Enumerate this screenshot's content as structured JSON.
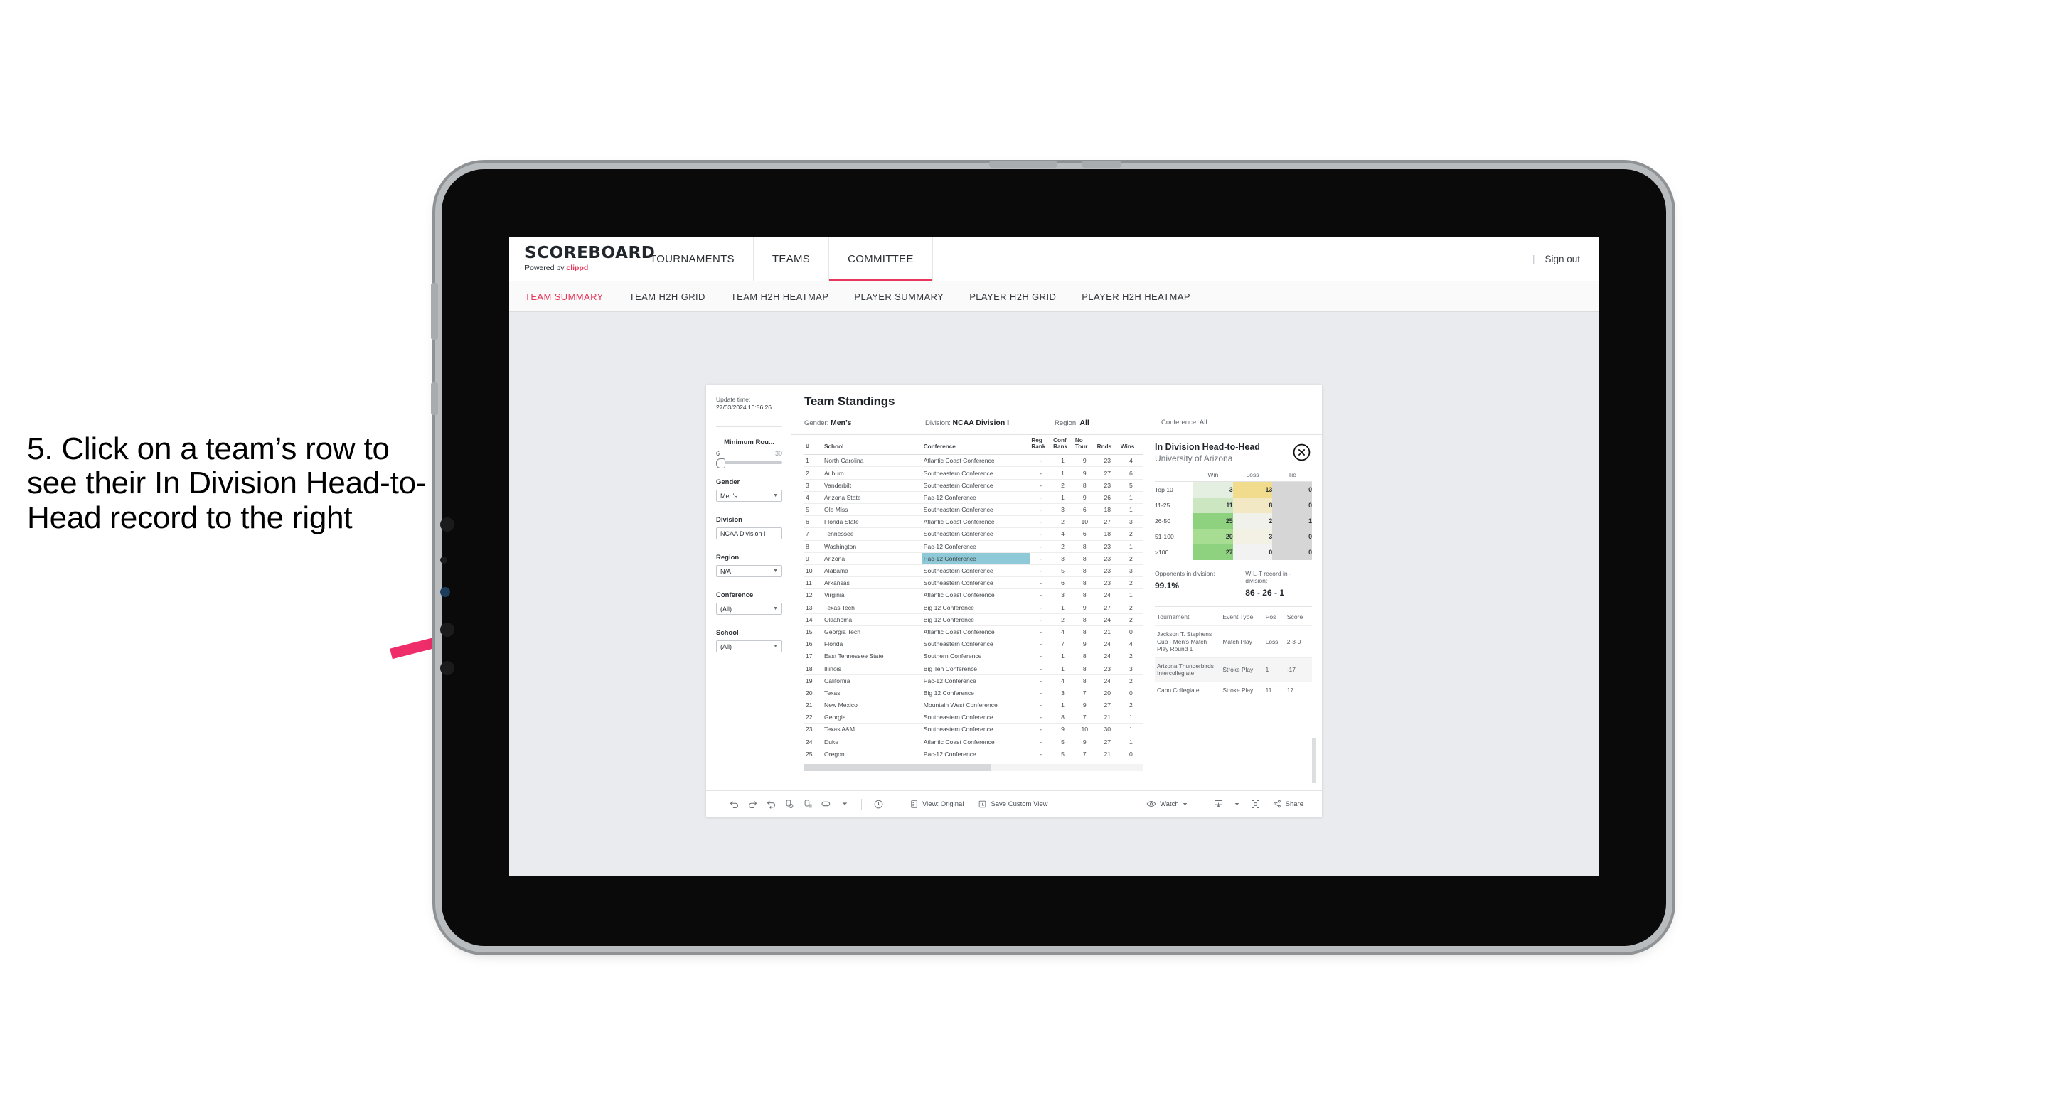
{
  "annotation": {
    "text": "5. Click on a team’s row to see their In Division Head-to-Head record to the right"
  },
  "app": {
    "logo_word": "SCOREBOARD",
    "logo_sub_prefix": "Powered by ",
    "logo_sub_brand": "clippd",
    "nav": [
      {
        "label": "TOURNAMENTS",
        "active": false
      },
      {
        "label": "TEAMS",
        "active": false
      },
      {
        "label": "COMMITTEE",
        "active": true
      }
    ],
    "sign_out": "Sign out",
    "subtabs": [
      {
        "label": "TEAM SUMMARY",
        "active": true
      },
      {
        "label": "TEAM H2H GRID",
        "active": false
      },
      {
        "label": "TEAM H2H HEATMAP",
        "active": false
      },
      {
        "label": "PLAYER SUMMARY",
        "active": false
      },
      {
        "label": "PLAYER H2H GRID",
        "active": false
      },
      {
        "label": "PLAYER H2H HEATMAP",
        "active": false
      }
    ]
  },
  "filters": {
    "update_time_label": "Update time:",
    "update_time_value": "27/03/2024 16:56:26",
    "min_rounds": {
      "label": "Minimum Rou...",
      "low": "6",
      "high": "30"
    },
    "groups": [
      {
        "label": "Gender",
        "value": "Men’s"
      },
      {
        "label": "Division",
        "value": "NCAA Division I"
      },
      {
        "label": "Region",
        "value": "N/A"
      },
      {
        "label": "Conference",
        "value": "(All)"
      },
      {
        "label": "School",
        "value": "(All)"
      }
    ]
  },
  "standings": {
    "title": "Team Standings",
    "crumbs": [
      {
        "key": "Gender: ",
        "value": "Men’s"
      },
      {
        "key": "Division: ",
        "value": "NCAA Division I"
      },
      {
        "key": "Region: ",
        "value": "All"
      },
      {
        "key": "Conference: ",
        "value": "All"
      }
    ],
    "columns": [
      "#",
      "School",
      "Conference",
      "Reg Rank",
      "Conf Rank",
      "No Tour",
      "Rnds",
      "Wins"
    ],
    "rows": [
      {
        "n": "1",
        "school": "North Carolina",
        "conf": "Atlantic Coast Conference",
        "reg": "-",
        "cr": "1",
        "nt": "9",
        "rnds": "23",
        "wins": "4",
        "hl": false
      },
      {
        "n": "2",
        "school": "Auburn",
        "conf": "Southeastern Conference",
        "reg": "-",
        "cr": "1",
        "nt": "9",
        "rnds": "27",
        "wins": "6",
        "hl": false
      },
      {
        "n": "3",
        "school": "Vanderbilt",
        "conf": "Southeastern Conference",
        "reg": "-",
        "cr": "2",
        "nt": "8",
        "rnds": "23",
        "wins": "5",
        "hl": false
      },
      {
        "n": "4",
        "school": "Arizona State",
        "conf": "Pac-12 Conference",
        "reg": "-",
        "cr": "1",
        "nt": "9",
        "rnds": "26",
        "wins": "1",
        "hl": false
      },
      {
        "n": "5",
        "school": "Ole Miss",
        "conf": "Southeastern Conference",
        "reg": "-",
        "cr": "3",
        "nt": "6",
        "rnds": "18",
        "wins": "1",
        "hl": false
      },
      {
        "n": "6",
        "school": "Florida State",
        "conf": "Atlantic Coast Conference",
        "reg": "-",
        "cr": "2",
        "nt": "10",
        "rnds": "27",
        "wins": "3",
        "hl": false
      },
      {
        "n": "7",
        "school": "Tennessee",
        "conf": "Southeastern Conference",
        "reg": "-",
        "cr": "4",
        "nt": "6",
        "rnds": "18",
        "wins": "2",
        "hl": false
      },
      {
        "n": "8",
        "school": "Washington",
        "conf": "Pac-12 Conference",
        "reg": "-",
        "cr": "2",
        "nt": "8",
        "rnds": "23",
        "wins": "1",
        "hl": false
      },
      {
        "n": "9",
        "school": "Arizona",
        "conf": "Pac-12 Conference",
        "reg": "-",
        "cr": "3",
        "nt": "8",
        "rnds": "23",
        "wins": "2",
        "hl": true
      },
      {
        "n": "10",
        "school": "Alabama",
        "conf": "Southeastern Conference",
        "reg": "-",
        "cr": "5",
        "nt": "8",
        "rnds": "23",
        "wins": "3",
        "hl": false
      },
      {
        "n": "11",
        "school": "Arkansas",
        "conf": "Southeastern Conference",
        "reg": "-",
        "cr": "6",
        "nt": "8",
        "rnds": "23",
        "wins": "2",
        "hl": false
      },
      {
        "n": "12",
        "school": "Virginia",
        "conf": "Atlantic Coast Conference",
        "reg": "-",
        "cr": "3",
        "nt": "8",
        "rnds": "24",
        "wins": "1",
        "hl": false
      },
      {
        "n": "13",
        "school": "Texas Tech",
        "conf": "Big 12 Conference",
        "reg": "-",
        "cr": "1",
        "nt": "9",
        "rnds": "27",
        "wins": "2",
        "hl": false
      },
      {
        "n": "14",
        "school": "Oklahoma",
        "conf": "Big 12 Conference",
        "reg": "-",
        "cr": "2",
        "nt": "8",
        "rnds": "24",
        "wins": "2",
        "hl": false
      },
      {
        "n": "15",
        "school": "Georgia Tech",
        "conf": "Atlantic Coast Conference",
        "reg": "-",
        "cr": "4",
        "nt": "8",
        "rnds": "21",
        "wins": "0",
        "hl": false
      },
      {
        "n": "16",
        "school": "Florida",
        "conf": "Southeastern Conference",
        "reg": "-",
        "cr": "7",
        "nt": "9",
        "rnds": "24",
        "wins": "4",
        "hl": false
      },
      {
        "n": "17",
        "school": "East Tennessee State",
        "conf": "Southern Conference",
        "reg": "-",
        "cr": "1",
        "nt": "8",
        "rnds": "24",
        "wins": "2",
        "hl": false
      },
      {
        "n": "18",
        "school": "Illinois",
        "conf": "Big Ten Conference",
        "reg": "-",
        "cr": "1",
        "nt": "8",
        "rnds": "23",
        "wins": "3",
        "hl": false
      },
      {
        "n": "19",
        "school": "California",
        "conf": "Pac-12 Conference",
        "reg": "-",
        "cr": "4",
        "nt": "8",
        "rnds": "24",
        "wins": "2",
        "hl": false
      },
      {
        "n": "20",
        "school": "Texas",
        "conf": "Big 12 Conference",
        "reg": "-",
        "cr": "3",
        "nt": "7",
        "rnds": "20",
        "wins": "0",
        "hl": false
      },
      {
        "n": "21",
        "school": "New Mexico",
        "conf": "Mountain West Conference",
        "reg": "-",
        "cr": "1",
        "nt": "9",
        "rnds": "27",
        "wins": "2",
        "hl": false
      },
      {
        "n": "22",
        "school": "Georgia",
        "conf": "Southeastern Conference",
        "reg": "-",
        "cr": "8",
        "nt": "7",
        "rnds": "21",
        "wins": "1",
        "hl": false
      },
      {
        "n": "23",
        "school": "Texas A&M",
        "conf": "Southeastern Conference",
        "reg": "-",
        "cr": "9",
        "nt": "10",
        "rnds": "30",
        "wins": "1",
        "hl": false
      },
      {
        "n": "24",
        "school": "Duke",
        "conf": "Atlantic Coast Conference",
        "reg": "-",
        "cr": "5",
        "nt": "9",
        "rnds": "27",
        "wins": "1",
        "hl": false
      },
      {
        "n": "25",
        "school": "Oregon",
        "conf": "Pac-12 Conference",
        "reg": "-",
        "cr": "5",
        "nt": "7",
        "rnds": "21",
        "wins": "0",
        "hl": false
      }
    ]
  },
  "h2h": {
    "title": "In Division Head-to-Head",
    "subtitle": "University of Arizona",
    "close_icon": "close-circle-icon",
    "columns": [
      "",
      "Win",
      "Loss",
      "Tie"
    ],
    "rows": [
      {
        "label": "Top 10",
        "win": "3",
        "loss": "13",
        "tie": "0",
        "win_color": "#e4efe1",
        "loss_color": "#f0dc8c",
        "tie_color": "#d6d6d6"
      },
      {
        "label": "11-25",
        "win": "11",
        "loss": "8",
        "tie": "0",
        "win_color": "#cbe6c0",
        "loss_color": "#f2e9c4",
        "tie_color": "#d6d6d6"
      },
      {
        "label": "26-50",
        "win": "25",
        "loss": "2",
        "tie": "1",
        "win_color": "#8ed17e",
        "loss_color": "#f1f1ec",
        "tie_color": "#d6d6d6"
      },
      {
        "label": "51-100",
        "win": "20",
        "loss": "3",
        "tie": "0",
        "win_color": "#a7dc93",
        "loss_color": "#f3f0e4",
        "tie_color": "#d6d6d6"
      },
      {
        "label": ">100",
        "win": "27",
        "loss": "0",
        "tie": "0",
        "win_color": "#8ed17e",
        "loss_color": "#f2f2f2",
        "tie_color": "#d6d6d6"
      }
    ],
    "stats": [
      {
        "key": "Opponents in division:",
        "value": "99.1%"
      },
      {
        "key": "W-L-T record in -division:",
        "value": "86 - 26 - 1"
      }
    ],
    "tourn_columns": [
      "Tournament",
      "Event Type",
      "Pos",
      "Score"
    ],
    "tourn_rows": [
      {
        "name": "Jackson T. Stephens Cup - Men’s Match Play Round 1",
        "type": "Match Play",
        "pos": "Loss",
        "score": "2-3-0"
      },
      {
        "name": "Arizona Thunderbirds Intercollegiate",
        "type": "Stroke Play",
        "pos": "1",
        "score": "-17"
      },
      {
        "name": "Cabo Collegiate",
        "type": "Stroke Play",
        "pos": "11",
        "score": "17"
      }
    ]
  },
  "toolbar": {
    "icons": [
      "undo-icon",
      "redo-icon",
      "revert-icon",
      "refresh-data-icon",
      "pause-updates-icon",
      "device-layout-icon"
    ],
    "clock_icon": "history-icon",
    "view_label": "View: Original",
    "view_icon": "view-icon",
    "save_label": "Save Custom View",
    "save_icon": "save-view-icon",
    "watch_label": "Watch",
    "watch_icon": "eye-icon",
    "download_icon": "download-icon",
    "fullscreen_icon": "fullscreen-icon",
    "share_label": "Share",
    "share_icon": "share-icon"
  },
  "colors": {
    "accent": "#e8375a",
    "highlight_row": "#8ec9d8",
    "arrow": "#ef2d6a"
  }
}
